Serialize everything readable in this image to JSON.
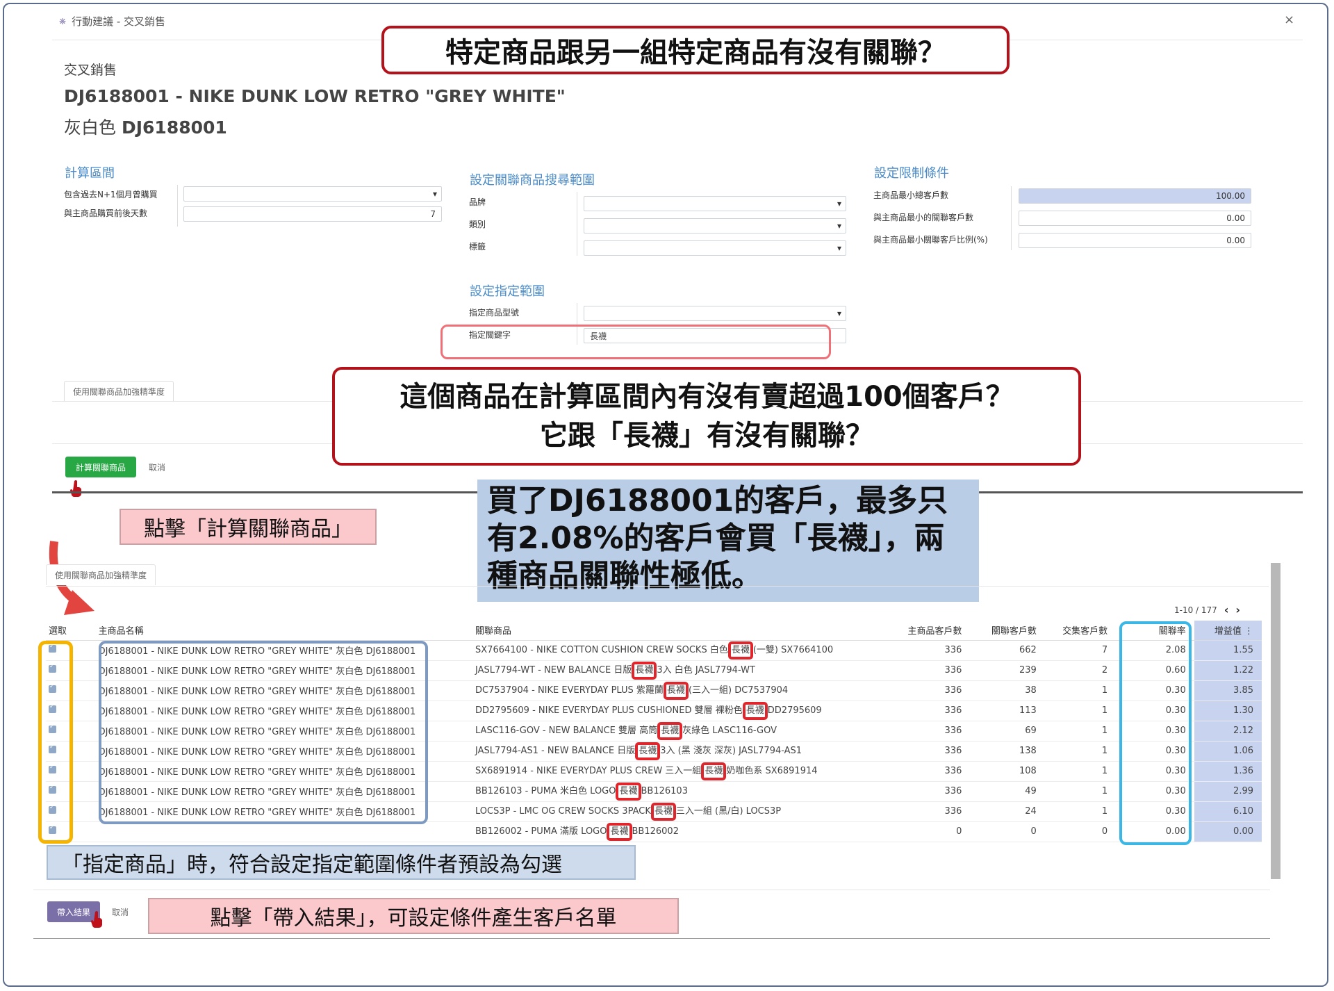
{
  "header": {
    "icon": "star-badge-icon",
    "breadcrumb": "行動建議 - 交叉銷售",
    "close": "×"
  },
  "form": {
    "subtitle": "交叉銷售",
    "product_title": "DJ6188001 - NIKE DUNK LOW RETRO \"GREY WHITE\"",
    "product_color": "灰白色",
    "product_code": "DJ6188001"
  },
  "calc_range": {
    "title": "計算區間",
    "months_label": "包含過去N+1個月曾購買",
    "months_value": "",
    "days_label": "與主商品購買前後天數",
    "days_value": "7"
  },
  "search_range": {
    "title": "設定關聯商品搜尋範圍",
    "brand_label": "品牌",
    "category_label": "類別",
    "tag_label": "標籤"
  },
  "limits": {
    "title": "設定限制條件",
    "min_total_label": "主商品最小總客戶數",
    "min_total_value": "100.00",
    "min_related_label": "與主商品最小的關聯客戶數",
    "min_related_value": "0.00",
    "min_ratio_label": "與主商品最小關聯客戶比例(%)",
    "min_ratio_value": "0.00"
  },
  "specified_range": {
    "title": "設定指定範圍",
    "model_label": "指定商品型號",
    "keyword_label": "指定關鍵字",
    "keyword_value": "長襪"
  },
  "tab_label": "使用關聯商品加強精準度",
  "actions": {
    "compute": "計算關聯商品",
    "cancel": "取消",
    "import": "帶入結果",
    "cancel2": "取消"
  },
  "callouts": {
    "top_question": "特定商品跟另一組特定商品有沒有關聯？",
    "middle_question_line1": "這個商品在計算區間內有沒有賣超過100個客戶？",
    "middle_question_line2": "它跟「長襪」有沒有關聯？",
    "click_compute": "點擊「計算關聯商品」",
    "conclusion": "買了DJ6188001的客戶，最多只有2.08%的客戶會買「長襪」，兩種商品關聯性極低。",
    "default_checked": "「指定商品」時，符合設定指定範圍條件者預設為勾選",
    "click_import": "點擊「帶入結果」，可設定條件產生客戶名單"
  },
  "results": {
    "pager": "1-10 / 177",
    "columns": [
      "選取",
      "主商品名稱",
      "關聯商品",
      "主商品客戶數",
      "關聯客戶數",
      "交集客戶數",
      "關聯率",
      "增益值"
    ],
    "rows": [
      {
        "checked": true,
        "main": "DJ6188001 - NIKE DUNK LOW RETRO \"GREY WHITE\" 灰白色 DJ6188001",
        "rel_a": "SX7664100 - NIKE COTTON CUSHION CREW SOCKS 白色",
        "kw": "長襪",
        "rel_b": "(一雙) SX7664100",
        "main_cust": "336",
        "rel_cust": "662",
        "inter": "7",
        "rate": "2.08",
        "lift": "1.55"
      },
      {
        "checked": true,
        "main": "DJ6188001 - NIKE DUNK LOW RETRO \"GREY WHITE\" 灰白色 DJ6188001",
        "rel_a": "JASL7794-WT - NEW BALANCE 日版",
        "kw": "長襪",
        "rel_b": "3入 白色 JASL7794-WT",
        "main_cust": "336",
        "rel_cust": "239",
        "inter": "2",
        "rate": "0.60",
        "lift": "1.22"
      },
      {
        "checked": true,
        "main": "DJ6188001 - NIKE DUNK LOW RETRO \"GREY WHITE\" 灰白色 DJ6188001",
        "rel_a": "DC7537904 - NIKE EVERYDAY PLUS 紫羅蘭",
        "kw": "長襪",
        "rel_b": "(三入一組) DC7537904",
        "main_cust": "336",
        "rel_cust": "38",
        "inter": "1",
        "rate": "0.30",
        "lift": "3.85"
      },
      {
        "checked": true,
        "main": "DJ6188001 - NIKE DUNK LOW RETRO \"GREY WHITE\" 灰白色 DJ6188001",
        "rel_a": "DD2795609 - NIKE EVERYDAY PLUS CUSHIONED 雙層 裸粉色",
        "kw": "長襪",
        "rel_b": "DD2795609",
        "main_cust": "336",
        "rel_cust": "113",
        "inter": "1",
        "rate": "0.30",
        "lift": "1.30"
      },
      {
        "checked": true,
        "main": "DJ6188001 - NIKE DUNK LOW RETRO \"GREY WHITE\" 灰白色 DJ6188001",
        "rel_a": "LASC116-GOV - NEW BALANCE 雙層 高筒",
        "kw": "長襪",
        "rel_b": "灰綠色 LASC116-GOV",
        "main_cust": "336",
        "rel_cust": "69",
        "inter": "1",
        "rate": "0.30",
        "lift": "2.12"
      },
      {
        "checked": true,
        "main": "DJ6188001 - NIKE DUNK LOW RETRO \"GREY WHITE\" 灰白色 DJ6188001",
        "rel_a": "JASL7794-AS1 - NEW BALANCE 日版",
        "kw": "長襪",
        "rel_b": "3入 (黑 淺灰 深灰) JASL7794-AS1",
        "main_cust": "336",
        "rel_cust": "138",
        "inter": "1",
        "rate": "0.30",
        "lift": "1.06"
      },
      {
        "checked": true,
        "main": "DJ6188001 - NIKE DUNK LOW RETRO \"GREY WHITE\" 灰白色 DJ6188001",
        "rel_a": "SX6891914 - NIKE EVERYDAY PLUS CREW 三入一組",
        "kw": "長襪",
        "rel_b": "奶咖色系 SX6891914",
        "main_cust": "336",
        "rel_cust": "108",
        "inter": "1",
        "rate": "0.30",
        "lift": "1.36"
      },
      {
        "checked": true,
        "main": "DJ6188001 - NIKE DUNK LOW RETRO \"GREY WHITE\" 灰白色 DJ6188001",
        "rel_a": "BB126103 - PUMA 米白色 LOGO",
        "kw": "長襪",
        "rel_b": "BB126103",
        "main_cust": "336",
        "rel_cust": "49",
        "inter": "1",
        "rate": "0.30",
        "lift": "2.99"
      },
      {
        "checked": true,
        "main": "DJ6188001 - NIKE DUNK LOW RETRO \"GREY WHITE\" 灰白色 DJ6188001",
        "rel_a": "LOCS3P - LMC OG CREW SOCKS 3PACK",
        "kw": "長襪",
        "rel_b": "三入一組 (黑/白) LOCS3P",
        "main_cust": "336",
        "rel_cust": "24",
        "inter": "1",
        "rate": "0.30",
        "lift": "6.10"
      },
      {
        "checked": true,
        "main": "",
        "rel_a": "BB126002 - PUMA 滿版 LOGO",
        "kw": "長襪",
        "rel_b": "BB126002",
        "main_cust": "0",
        "rel_cust": "0",
        "inter": "0",
        "rate": "0.00",
        "lift": "0.00"
      }
    ]
  },
  "colors": {
    "red": "#b3121a",
    "green": "#28a745",
    "purple": "#7b6fa8",
    "yellow": "#f4b400",
    "cyan": "#3bb7e6",
    "steel": "#7f9ac0"
  }
}
